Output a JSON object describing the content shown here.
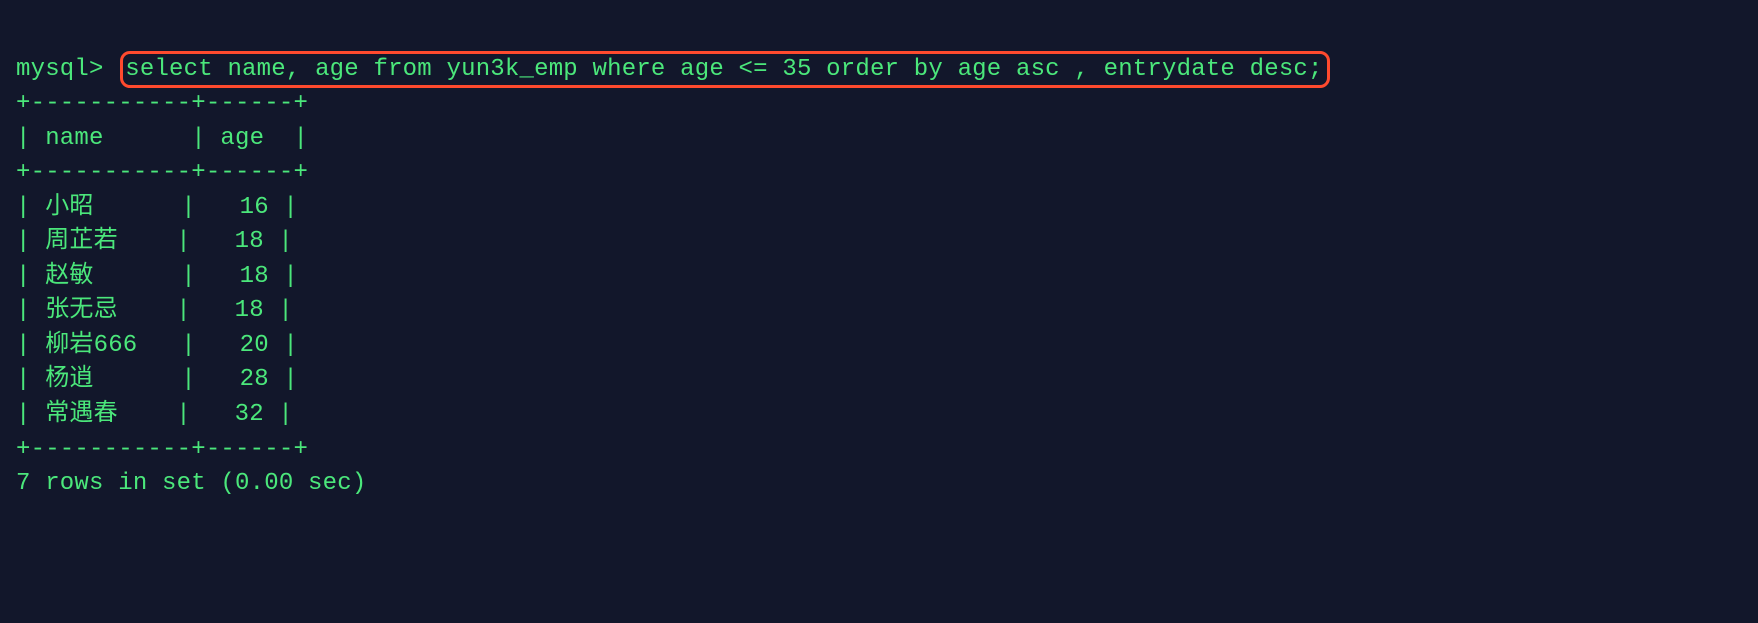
{
  "prompt": "mysql>",
  "query": "select name, age from yun3k_emp where age <= 35 order by age asc , entrydate desc;",
  "table": {
    "border": "+-----------+------+",
    "header": "| name      | age  |",
    "rows": [
      "| 小昭      |   16 |",
      "| 周芷若    |   18 |",
      "| 赵敏      |   18 |",
      "| 张无忌    |   18 |",
      "| 柳岩666   |   20 |",
      "| 杨逍      |   28 |",
      "| 常遇春    |   32 |"
    ]
  },
  "summary": "7 rows in set (0.00 sec)",
  "chart_data": {
    "type": "table",
    "columns": [
      "name",
      "age"
    ],
    "rows": [
      {
        "name": "小昭",
        "age": 16
      },
      {
        "name": "周芷若",
        "age": 18
      },
      {
        "name": "赵敏",
        "age": 18
      },
      {
        "name": "张无忌",
        "age": 18
      },
      {
        "name": "柳岩666",
        "age": 20
      },
      {
        "name": "杨逍",
        "age": 28
      },
      {
        "name": "常遇春",
        "age": 32
      }
    ],
    "row_count": 7,
    "elapsed_sec": 0.0
  }
}
